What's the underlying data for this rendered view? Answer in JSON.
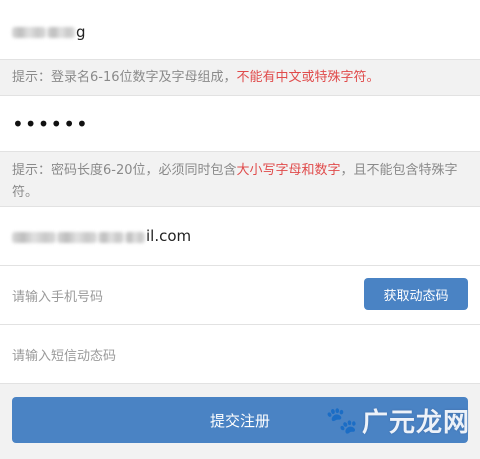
{
  "username": {
    "visible_suffix": "g"
  },
  "username_hint": {
    "normal": "提示：登录名6-16位数字及字母组成，",
    "warning": "不能有中文或特殊字符。"
  },
  "password": {
    "masked_value": "••••••"
  },
  "password_hint": {
    "part1": "提示：密码长度6-20位，必须同时包含",
    "warning": "大小写字母和数字",
    "part2": "，且不能包含特殊字符。"
  },
  "email": {
    "visible_suffix": "il.com"
  },
  "phone": {
    "placeholder": "请输入手机号码",
    "sms_button_label": "获取动态码"
  },
  "sms_code": {
    "placeholder": "请输入短信动态码"
  },
  "submit": {
    "label": "提交注册"
  },
  "watermark": {
    "text": "广元龙网"
  },
  "colors": {
    "accent": "#4a83c4",
    "warning": "#e04b4b"
  }
}
